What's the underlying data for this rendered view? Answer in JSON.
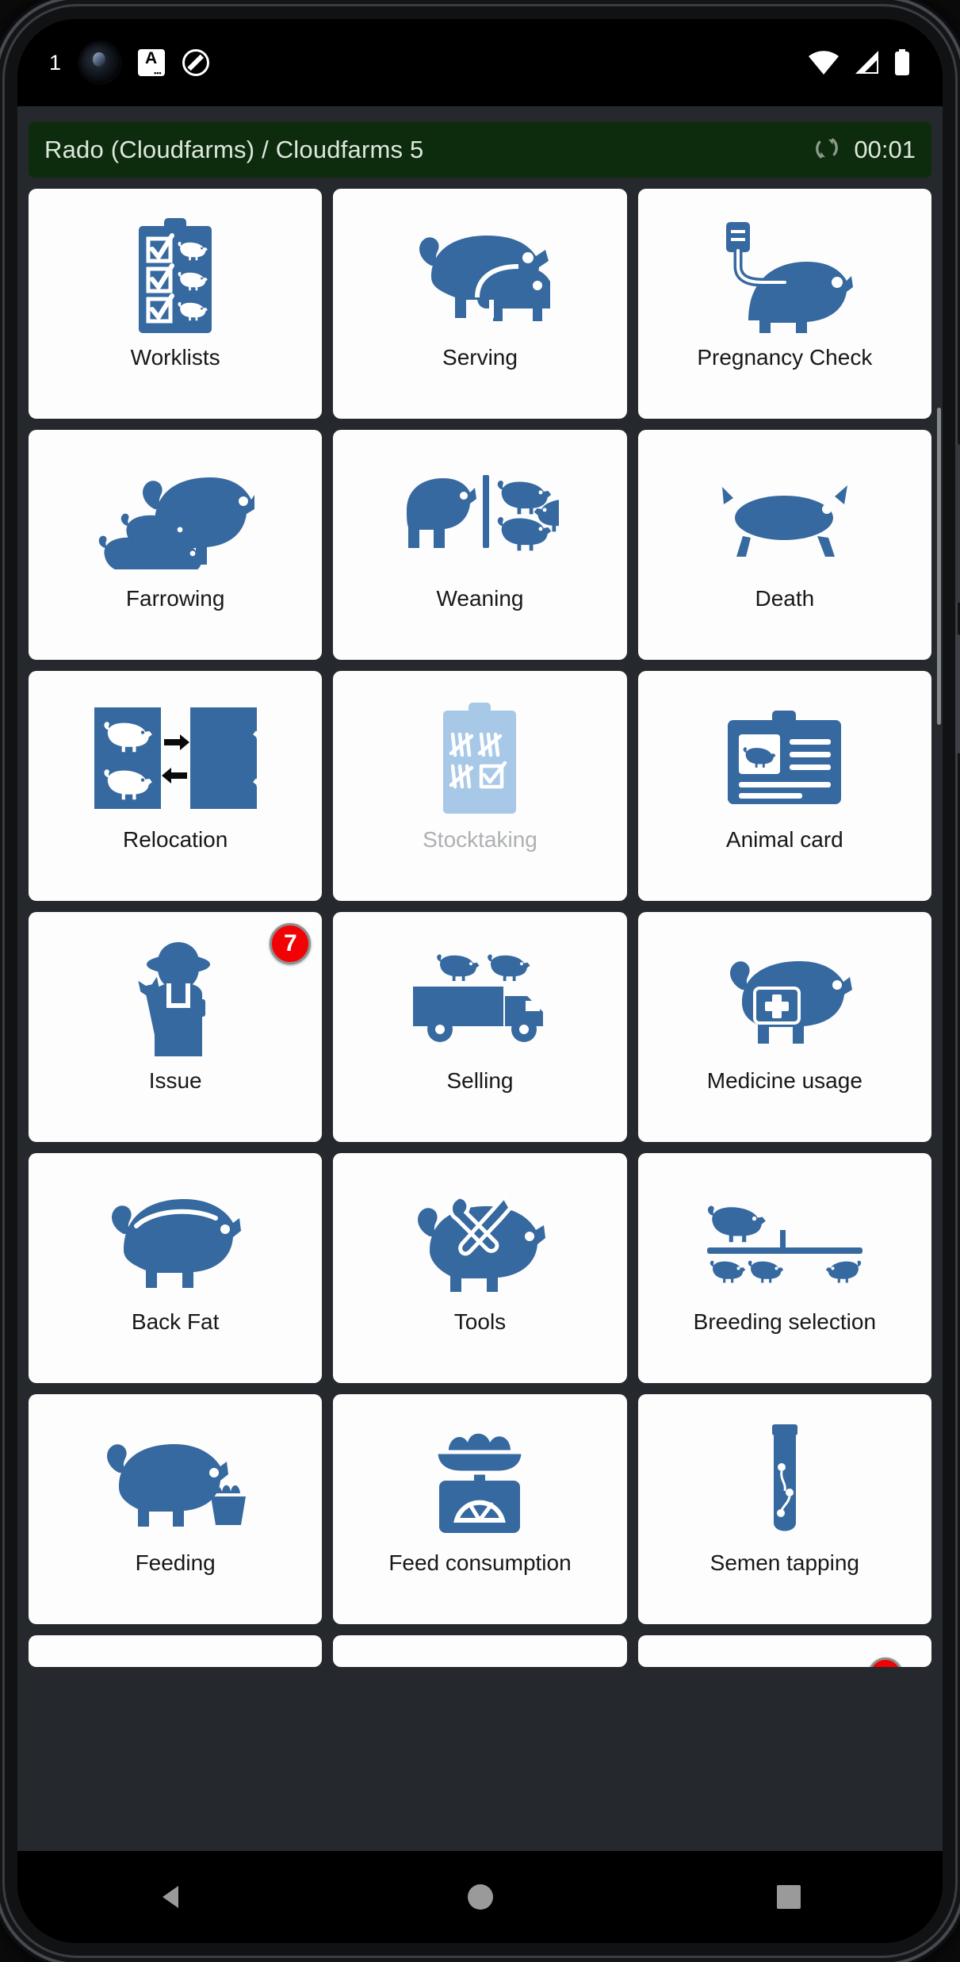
{
  "status_bar": {
    "notification_count": "1",
    "icons_left": [
      "camera-punch-hole",
      "keyboard-icon",
      "dnd-icon"
    ],
    "keyboard_glyph": "A",
    "icons_right": [
      "wifi-icon",
      "cellular-signal-icon",
      "battery-icon"
    ]
  },
  "header": {
    "farm_title": "Rado (Cloudfarms) / Cloudfarms 5",
    "sync_icon": "sync-icon",
    "timer": "00:01",
    "background_color": "#0d2b0d",
    "text_color": "#dde8dd"
  },
  "theme": {
    "accent_blue": "#36699f",
    "accent_blue_disabled": "#a8c8e8",
    "tile_background": "#fdfdfd",
    "app_background": "#25282c",
    "badge_red": "#f00205",
    "label_color": "#16181a",
    "label_disabled_color": "#aeb0b3"
  },
  "tiles": [
    {
      "id": "worklists",
      "label": "Worklists",
      "icon": "clipboard-pigs-icon",
      "enabled": true,
      "badge": null
    },
    {
      "id": "serving",
      "label": "Serving",
      "icon": "pigs-mating-icon",
      "enabled": true,
      "badge": null
    },
    {
      "id": "pregnancy-check",
      "label": "Pregnancy Check",
      "icon": "pig-ultrasound-icon",
      "enabled": true,
      "badge": null
    },
    {
      "id": "farrowing",
      "label": "Farrowing",
      "icon": "sow-piglets-icon",
      "enabled": true,
      "badge": null
    },
    {
      "id": "weaning",
      "label": "Weaning",
      "icon": "pig-separation-icon",
      "enabled": true,
      "badge": null
    },
    {
      "id": "death",
      "label": "Death",
      "icon": "dead-pig-icon",
      "enabled": true,
      "badge": null
    },
    {
      "id": "relocation",
      "label": "Relocation",
      "icon": "pig-transfer-icon",
      "enabled": true,
      "badge": null
    },
    {
      "id": "stocktaking",
      "label": "Stocktaking",
      "icon": "tally-clipboard-icon",
      "enabled": false,
      "badge": null
    },
    {
      "id": "animal-card",
      "label": "Animal card",
      "icon": "animal-id-card-icon",
      "enabled": true,
      "badge": null
    },
    {
      "id": "issue",
      "label": "Issue",
      "icon": "farmer-wrench-icon",
      "enabled": true,
      "badge": "7"
    },
    {
      "id": "selling",
      "label": "Selling",
      "icon": "pig-truck-icon",
      "enabled": true,
      "badge": null
    },
    {
      "id": "medicine-usage",
      "label": "Medicine usage",
      "icon": "pig-medkit-icon",
      "enabled": true,
      "badge": null
    },
    {
      "id": "back-fat",
      "label": "Back Fat",
      "icon": "pig-backfat-icon",
      "enabled": true,
      "badge": null
    },
    {
      "id": "tools",
      "label": "Tools",
      "icon": "pig-tools-icon",
      "enabled": true,
      "badge": null
    },
    {
      "id": "breeding-selection",
      "label": "Breeding selection",
      "icon": "breeding-pigs-icon",
      "enabled": true,
      "badge": null
    },
    {
      "id": "feeding",
      "label": "Feeding",
      "icon": "pig-trough-icon",
      "enabled": true,
      "badge": null
    },
    {
      "id": "feed-consumption",
      "label": "Feed consumption",
      "icon": "feed-scale-icon",
      "enabled": true,
      "badge": null
    },
    {
      "id": "semen-tapping",
      "label": "Semen tapping",
      "icon": "semen-tube-icon",
      "enabled": true,
      "badge": null
    }
  ],
  "partial_row": [
    {
      "id": "partial-tile-1",
      "label": "",
      "badge": null
    },
    {
      "id": "partial-tile-2",
      "label": "",
      "badge": null
    },
    {
      "id": "partial-tile-3",
      "label": "",
      "badge": ""
    }
  ],
  "nav_bar": {
    "buttons": [
      "back-nav-icon",
      "home-nav-icon",
      "recents-nav-icon"
    ]
  }
}
